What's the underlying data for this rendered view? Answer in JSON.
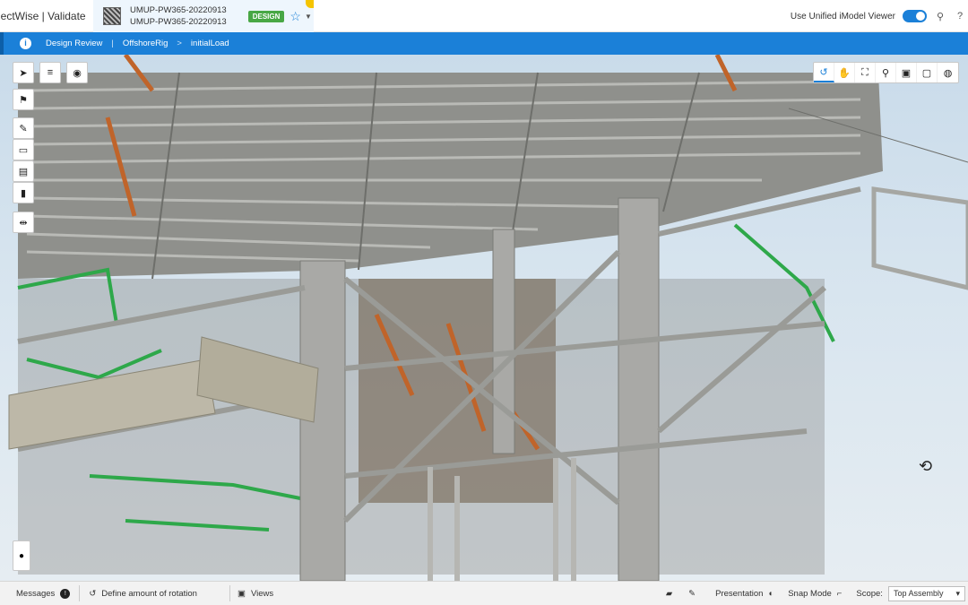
{
  "app": {
    "title": "jectWise | Validate"
  },
  "file_tab": {
    "name_line1": "UMUP-PW365-20220913",
    "name_line2": "UMUP-PW365-20220913",
    "badge": "DESIGN",
    "star_icon": "star-icon",
    "dropdown_icon": "caret-down-icon"
  },
  "header_right": {
    "unified_viewer_label": "Use Unified iModel Viewer",
    "unified_viewer_on": true,
    "help_icon": "lightbulb-icon",
    "extra_icon": "help-circle-icon"
  },
  "breadcrumb": {
    "items": [
      "Design Review",
      "OffshoreRig",
      "initialLoad"
    ],
    "separators": [
      "|",
      ">"
    ]
  },
  "viewport": {
    "scene": "offshore platform 3D model",
    "left_tools": [
      "select-icon",
      "menu-icon",
      "visibility-icon",
      "flag-icon",
      "measure-icon",
      "section-box-icon",
      "clip-icon",
      "column-icon",
      "split-icon"
    ],
    "view_tools": [
      "rotate-icon",
      "pan-icon",
      "fit-view-icon",
      "zoom-icon",
      "window-area-icon",
      "camera-icon",
      "walk-icon"
    ],
    "active_view_tool": "rotate-icon"
  },
  "statusbar": {
    "messages_label": "Messages",
    "messages_count": "!",
    "prompt": "Define amount of rotation",
    "views_label": "Views",
    "presentation_label": "Presentation",
    "snap_mode_label": "Snap Mode",
    "scope_label": "Scope:",
    "scope_value": "Top Assembly"
  },
  "colors": {
    "accent": "#1b80d8",
    "badge_green": "#48a745",
    "steel": "#a9a9a6",
    "pipe_orange": "#c0642a",
    "pipe_green": "#2ea84a"
  }
}
